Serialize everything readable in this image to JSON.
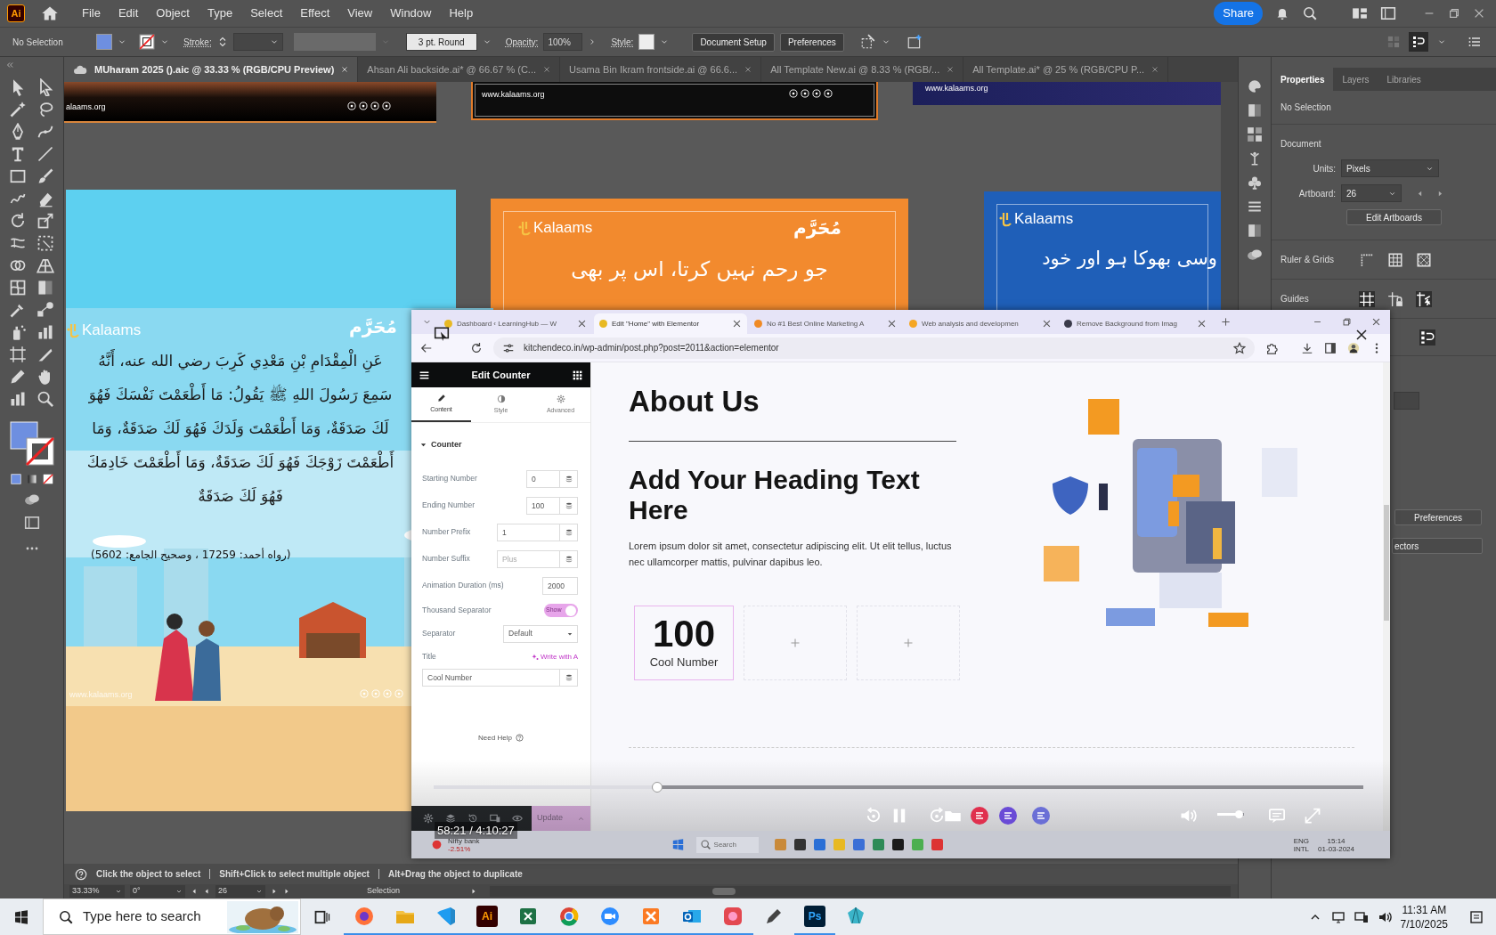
{
  "app_logo": "Ai",
  "menu": {
    "items": [
      "File",
      "Edit",
      "Object",
      "Type",
      "Select",
      "Effect",
      "View",
      "Window",
      "Help"
    ],
    "share": "Share"
  },
  "control_bar": {
    "selection": "No Selection",
    "stroke_label": "Stroke:",
    "brush": "3 pt. Round",
    "opacity_label": "Opacity:",
    "opacity": "100%",
    "style_label": "Style:",
    "buttons": [
      "Document Setup",
      "Preferences"
    ]
  },
  "doc_tabs": [
    {
      "label": "MUharam 2025 ().aic @ 33.33 % (RGB/CPU Preview)",
      "selected": true
    },
    {
      "label": "Ahsan Ali backside.ai* @ 66.67 % (C...",
      "selected": false
    },
    {
      "label": "Usama Bin Ikram frontside.ai @ 66.6...",
      "selected": false
    },
    {
      "label": "All Template New.ai @ 8.33 % (RGB/...",
      "selected": false
    },
    {
      "label": "All Template.ai* @ 25 % (RGB/CPU P...",
      "selected": false
    }
  ],
  "artboards": [
    {
      "kind": "footer",
      "site": "alaams.org"
    },
    {
      "kind": "footer",
      "site": "www.kalaams.org"
    },
    {
      "kind": "footer",
      "site": "www.kalaams.org"
    },
    {
      "kind": "blank",
      "color": "#5dd0f0"
    },
    {
      "kind": "urdu",
      "color": "#f28a2e",
      "logo": "Kalaams",
      "month": "مُحَرَّم",
      "line": "جو رحم نہیں کرتا، اس پر بھی"
    },
    {
      "kind": "urdu",
      "color": "#1f5fb8",
      "logo": "Kalaams",
      "line": "وسی بھوکا ہو اور خود"
    },
    {
      "kind": "hadith",
      "logo": "Kalaams",
      "month": "مُحَرَّم",
      "lines": [
        "عَنِ الْمِقْدَامِ بْنِ مَعْدِي كَرِبَ رضي الله عنه، أَنَّهُ",
        "سَمِعَ رَسُولَ اللهِ ﷺ يَقُولُ: مَا أَطْعَمْتَ نَفْسَكَ فَهُوَ",
        "لَكَ صَدَقَةٌ، وَمَا أَطْعَمْتَ وَلَدَكَ فَهُوَ لَكَ صَدَقَةٌ، وَمَا",
        "أَطْعَمْتَ زَوْجَكَ فَهُوَ لَكَ صَدَقَةٌ، وَمَا أَطْعَمْتَ خَادِمَكَ",
        "فَهُوَ لَكَ صَدَقَةٌ"
      ],
      "reference": "(رواه أحمد: 17259 ، وصحيح الجامع: 5602)",
      "site": "www.kalaams.org"
    }
  ],
  "properties_panel": {
    "tabs": [
      {
        "label": "Properties",
        "selected": true
      },
      {
        "label": "Layers",
        "selected": false
      },
      {
        "label": "Libraries",
        "selected": false
      }
    ],
    "selection": "No Selection",
    "section": "Document",
    "units_label": "Units:",
    "units": "Pixels",
    "artboard_label": "Artboard:",
    "artboard": "26",
    "edit_button": "Edit Artboards",
    "ruler_label": "Ruler & Grids",
    "guides_label": "Guides",
    "buttons": [
      "Preferences",
      "ectors"
    ]
  },
  "status_hint": [
    "Click the object to select",
    "Shift+Click to select multiple object",
    "Alt+Drag the object to duplicate"
  ],
  "zoom_bar": {
    "zoom": "33.33%",
    "rotation": "0°",
    "artboard": "26",
    "tool": "Selection"
  },
  "video": {
    "browser_tabs": [
      {
        "label": "Dashboard ‹ LearningHub — W",
        "selected": false,
        "color": "#e8b923"
      },
      {
        "label": "Edit \"Home\" with Elementor",
        "selected": true,
        "color": "#e8b923"
      },
      {
        "label": "No #1 Best Online Marketing A",
        "selected": false,
        "color": "#f08a24"
      },
      {
        "label": "Web analysis and developmen",
        "selected": false,
        "color": "#f5a623"
      },
      {
        "label": "Remove Background from Imag",
        "selected": false,
        "color": "#3a3a4a"
      }
    ],
    "url": "kitchendeco.in/wp-admin/post.php?post=2011&action=elementor",
    "elementor": {
      "title": "Edit Counter",
      "tabs": [
        {
          "label": "Content",
          "selected": true
        },
        {
          "label": "Style",
          "selected": false
        },
        {
          "label": "Advanced",
          "selected": false
        }
      ],
      "section": "Counter",
      "controls": [
        {
          "kind": "number",
          "label": "Starting Number",
          "value": "0"
        },
        {
          "kind": "number",
          "label": "Ending Number",
          "value": "100"
        },
        {
          "kind": "text",
          "label": "Number Prefix",
          "value": "1"
        },
        {
          "kind": "text",
          "label": "Number Suffix",
          "placeholder": "Plus"
        },
        {
          "kind": "plain",
          "label": "Animation Duration (ms)",
          "value": "2000"
        },
        {
          "kind": "switch",
          "label": "Thousand Separator",
          "on": true,
          "state_text": "Show"
        },
        {
          "kind": "select",
          "label": "Separator",
          "value": "Default"
        },
        {
          "kind": "title",
          "label": "Title",
          "ai_link": "Write with A",
          "value": "Cool Number"
        }
      ],
      "help": "Need Help",
      "update": "Update"
    },
    "page": {
      "heading": "About Us",
      "title": "Add Your Heading Text Here",
      "body": "Lorem ipsum dolor sit amet, consectetur adipiscing elit. Ut elit tellus, luctus nec ullamcorper mattis, pulvinar dapibus leo.",
      "counters": [
        {
          "kind": "counter",
          "number": "100",
          "title": "Cool Number"
        },
        {
          "kind": "empty"
        },
        {
          "kind": "empty"
        }
      ]
    },
    "recorded_taskbar": {
      "ticker": "Nifty bank",
      "change": "-2.51%",
      "search": "Search",
      "lang": "ENG",
      "layout": "INTL",
      "time": "15:14",
      "date": "01-03-2024"
    },
    "seek": {
      "level": 0.24
    },
    "time": "58:21 / 4:10:27",
    "volume": {
      "level": 0.8
    }
  },
  "taskbar": {
    "search_placeholder": "Type here to search",
    "apps": [
      {
        "kind": "firefox",
        "running": true
      },
      {
        "kind": "folder",
        "running": true
      },
      {
        "kind": "code",
        "running": true
      },
      {
        "kind": "tile",
        "label": "Ai",
        "color": "#330000",
        "running": true
      },
      {
        "kind": "sheet",
        "running": true
      },
      {
        "kind": "chrome",
        "running": true
      },
      {
        "kind": "video",
        "running": true
      },
      {
        "kind": "server",
        "running": true
      },
      {
        "kind": "mail",
        "running": true
      },
      {
        "kind": "cloud",
        "running": true
      },
      {
        "kind": "pen",
        "running": false
      },
      {
        "kind": "tile",
        "label": "Ps",
        "color": "#001e36",
        "running": true
      },
      {
        "kind": "gem",
        "running": false
      }
    ],
    "time": "11:31 AM",
    "date": "7/10/2025"
  }
}
